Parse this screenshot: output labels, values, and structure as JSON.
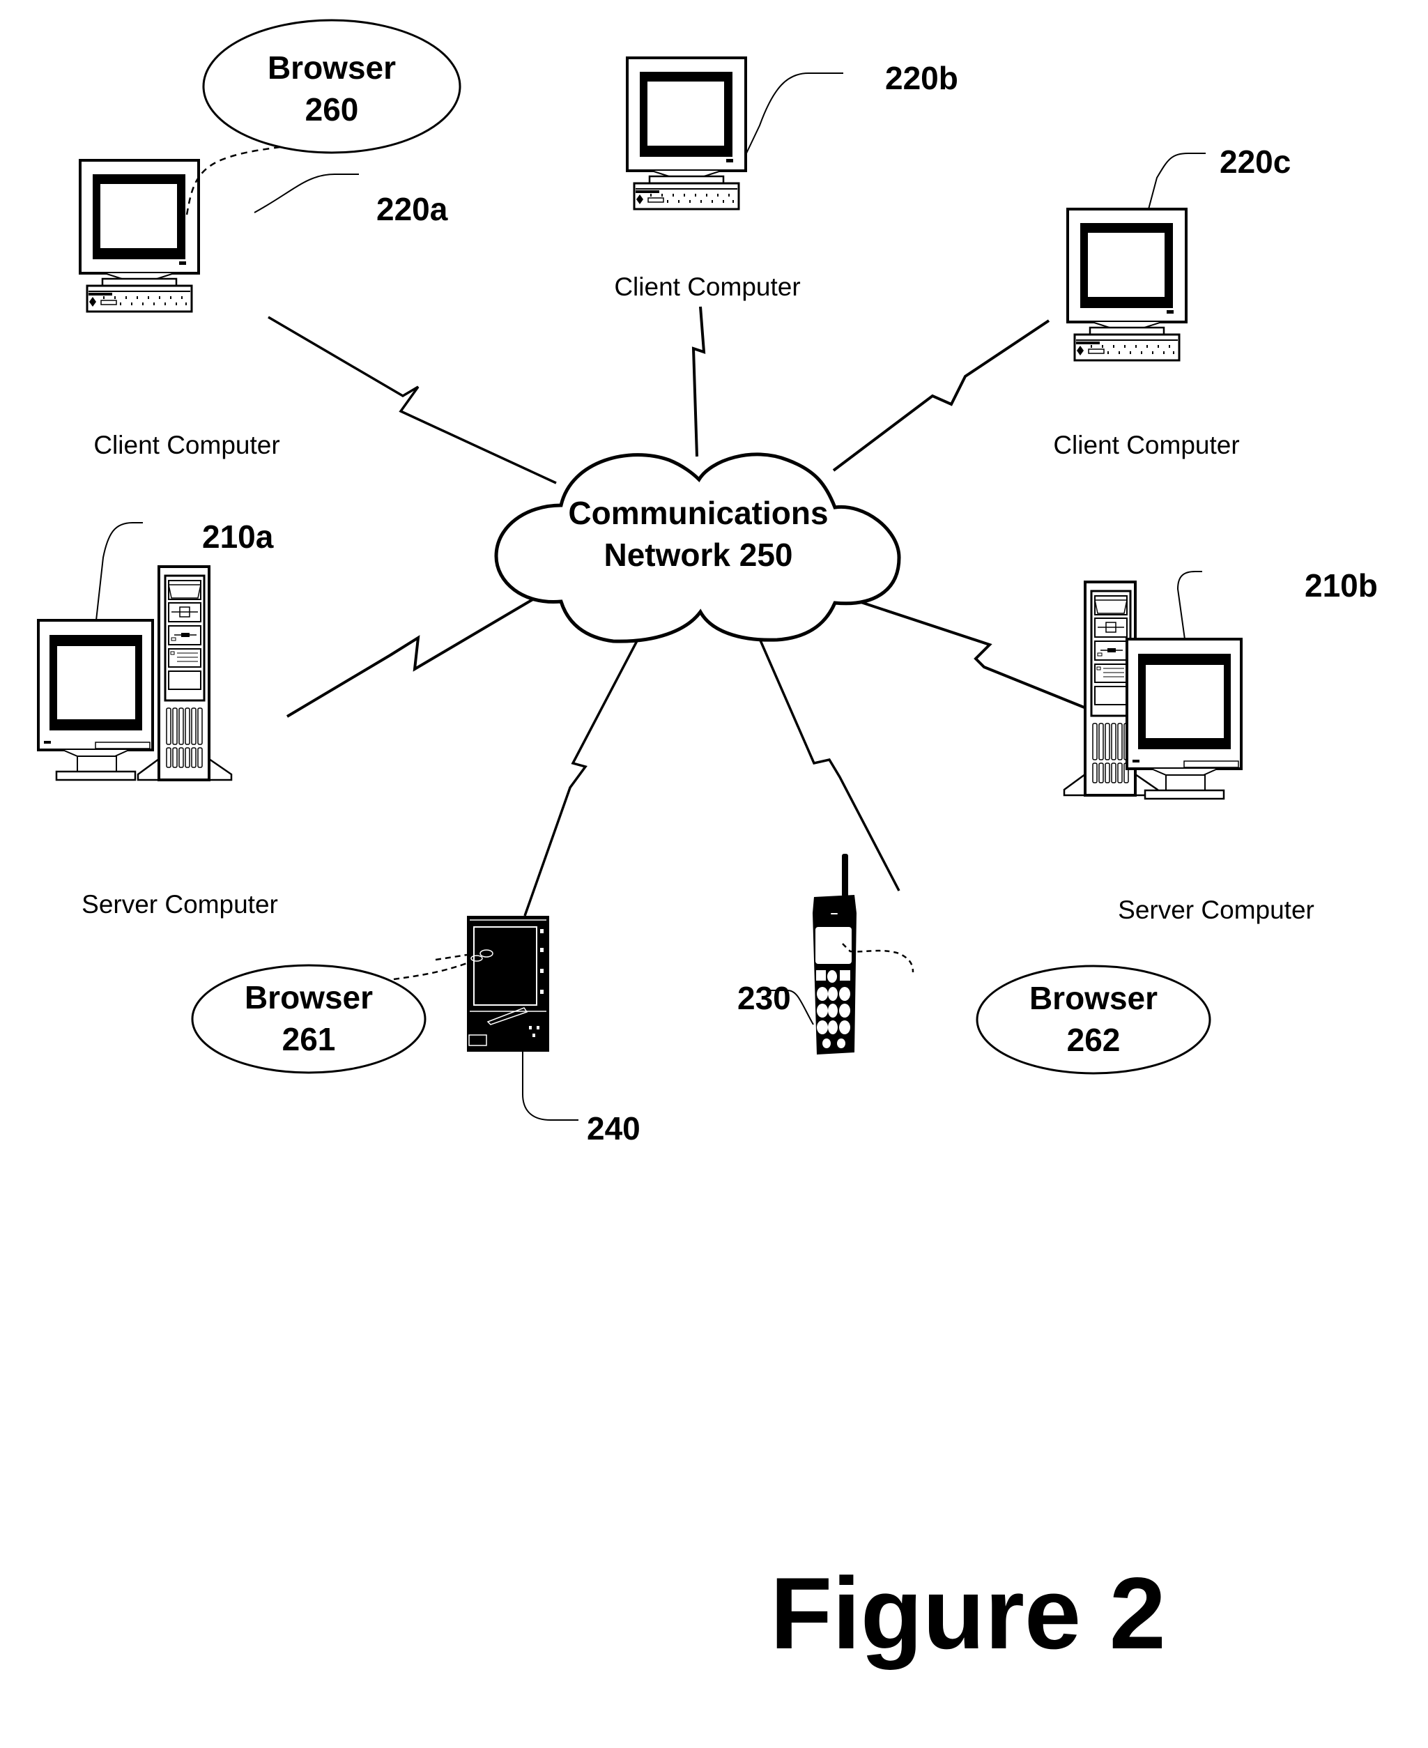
{
  "figure": {
    "caption": "Figure 2",
    "network": {
      "line1": "Communications",
      "line2": "Network 250"
    },
    "clients": [
      {
        "ref": "220a",
        "label": "Client Computer"
      },
      {
        "ref": "220b",
        "label": "Client Computer"
      },
      {
        "ref": "220c",
        "label": "Client Computer"
      }
    ],
    "servers": [
      {
        "ref": "210a",
        "label": "Server Computer"
      },
      {
        "ref": "210b",
        "label": "Server Computer"
      }
    ],
    "devices": {
      "pda": {
        "ref": "240"
      },
      "phone": {
        "ref": "230"
      }
    },
    "browsers": [
      {
        "line1": "Browser",
        "line2": "260"
      },
      {
        "line1": "Browser",
        "line2": "261"
      },
      {
        "line1": "Browser",
        "line2": "262"
      }
    ]
  }
}
